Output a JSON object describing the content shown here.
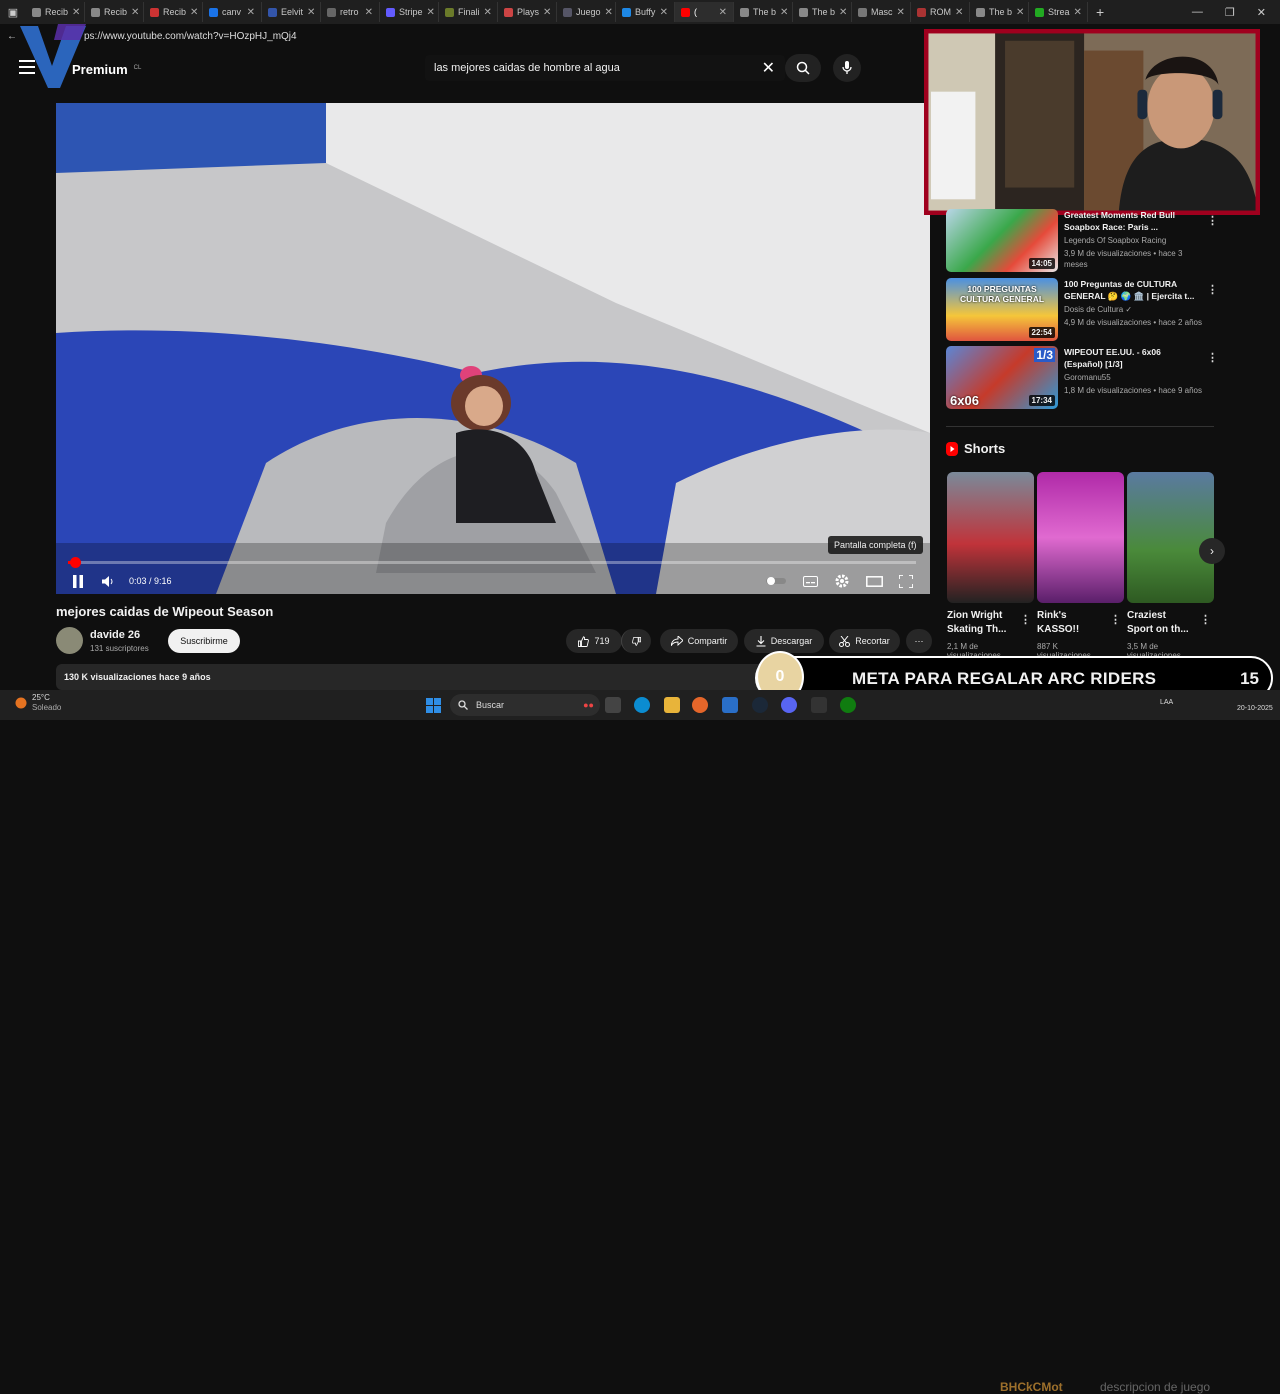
{
  "browser": {
    "tabs": [
      {
        "label": "Recib",
        "color": "#888"
      },
      {
        "label": "Recib",
        "color": "#888"
      },
      {
        "label": "Recib",
        "color": "#c33"
      },
      {
        "label": "canv",
        "color": "#1a73e8"
      },
      {
        "label": "Eelvit",
        "color": "#3355aa"
      },
      {
        "label": "retro",
        "color": "#666"
      },
      {
        "label": "Stripe",
        "color": "#635bff"
      },
      {
        "label": "Finali",
        "color": "#6b7b2a"
      },
      {
        "label": "Plays",
        "color": "#c44"
      },
      {
        "label": "Juego",
        "color": "#556"
      },
      {
        "label": "Buffy",
        "color": "#1e88e5"
      },
      {
        "label": "(",
        "color": "#f00",
        "active": true
      },
      {
        "label": "The b",
        "color": "#888"
      },
      {
        "label": "The b",
        "color": "#888"
      },
      {
        "label": "Masc",
        "color": "#777"
      },
      {
        "label": "ROM",
        "color": "#a33"
      },
      {
        "label": "The b",
        "color": "#888"
      },
      {
        "label": "Strea",
        "color": "#2a2"
      }
    ],
    "url": "ps://www.youtube.com/watch?v=HOzpHJ_mQj4"
  },
  "youtube": {
    "brand": "Premium",
    "country": "CL",
    "search_value": "las mejores caidas de hombre al agua",
    "player": {
      "progress": 0.008,
      "time": "0:03 / 9:16",
      "tooltip": "Pantalla completa (f)"
    },
    "video_title": "mejores caidas de Wipeout Season",
    "channel": "davide 26",
    "subscribers": "131 suscriptores",
    "subscribe_label": "Suscribirme",
    "likes": "719",
    "share_label": "Compartir",
    "download_label": "Descargar",
    "clip_label": "Recortar",
    "views_line": "130 K visualizaciones  hace 9 años",
    "recommended": [
      {
        "title_l1": "Greatest Moments Red Bull",
        "title_l2": "Soapbox Race: Paris ...",
        "channel": "Legends Of Soapbox Racing",
        "stats": "3,9 M de visualizaciones • hace 3 meses",
        "duration": "14:05"
      },
      {
        "title_l1": "100 Preguntas de CULTURA",
        "title_l2": "GENERAL 🤔 🌍 🏛️ | Ejercita t...",
        "channel": "Dosis de Cultura ✓",
        "stats": "4,9 M de visualizaciones • hace 2 años",
        "duration": "22:54",
        "thumb_text": "100 PREGUNTAS CULTURA GENERAL"
      },
      {
        "title_l1": "WIPEOUT EE.UU. - 6x06",
        "title_l2": "(Español) [1/3]",
        "channel": "Goromanu55",
        "stats": "1,8 M de visualizaciones • hace 9 años",
        "duration": "17:34",
        "thumb_text": "6x06",
        "thumb_badge": "1/3"
      }
    ],
    "shorts_header": "Shorts",
    "shorts": [
      {
        "title_l1": "Zion Wright",
        "title_l2": "Skating Th...",
        "views": "2,1 M de",
        "views2": "visualizaciones"
      },
      {
        "title_l1": "Rink's",
        "title_l2": "KASSO!!",
        "views": "887 K",
        "views2": "visualizaciones"
      },
      {
        "title_l1": "Craziest",
        "title_l2": "Sport on th...",
        "views": "3,5 M de",
        "views2": "visualizaciones"
      }
    ]
  },
  "stream_overlay": {
    "goal_current": "0",
    "goal_text": "META PARA REGALAR ARC RIDERS",
    "goal_target": "15",
    "brand_text": "BHCkCMot",
    "brand_text2": "descripcion de juego"
  },
  "taskbar": {
    "temp": "25°C",
    "weather": "Soleado",
    "search_placeholder": "Buscar",
    "lang": "LAA",
    "date": "20-10-2025"
  }
}
